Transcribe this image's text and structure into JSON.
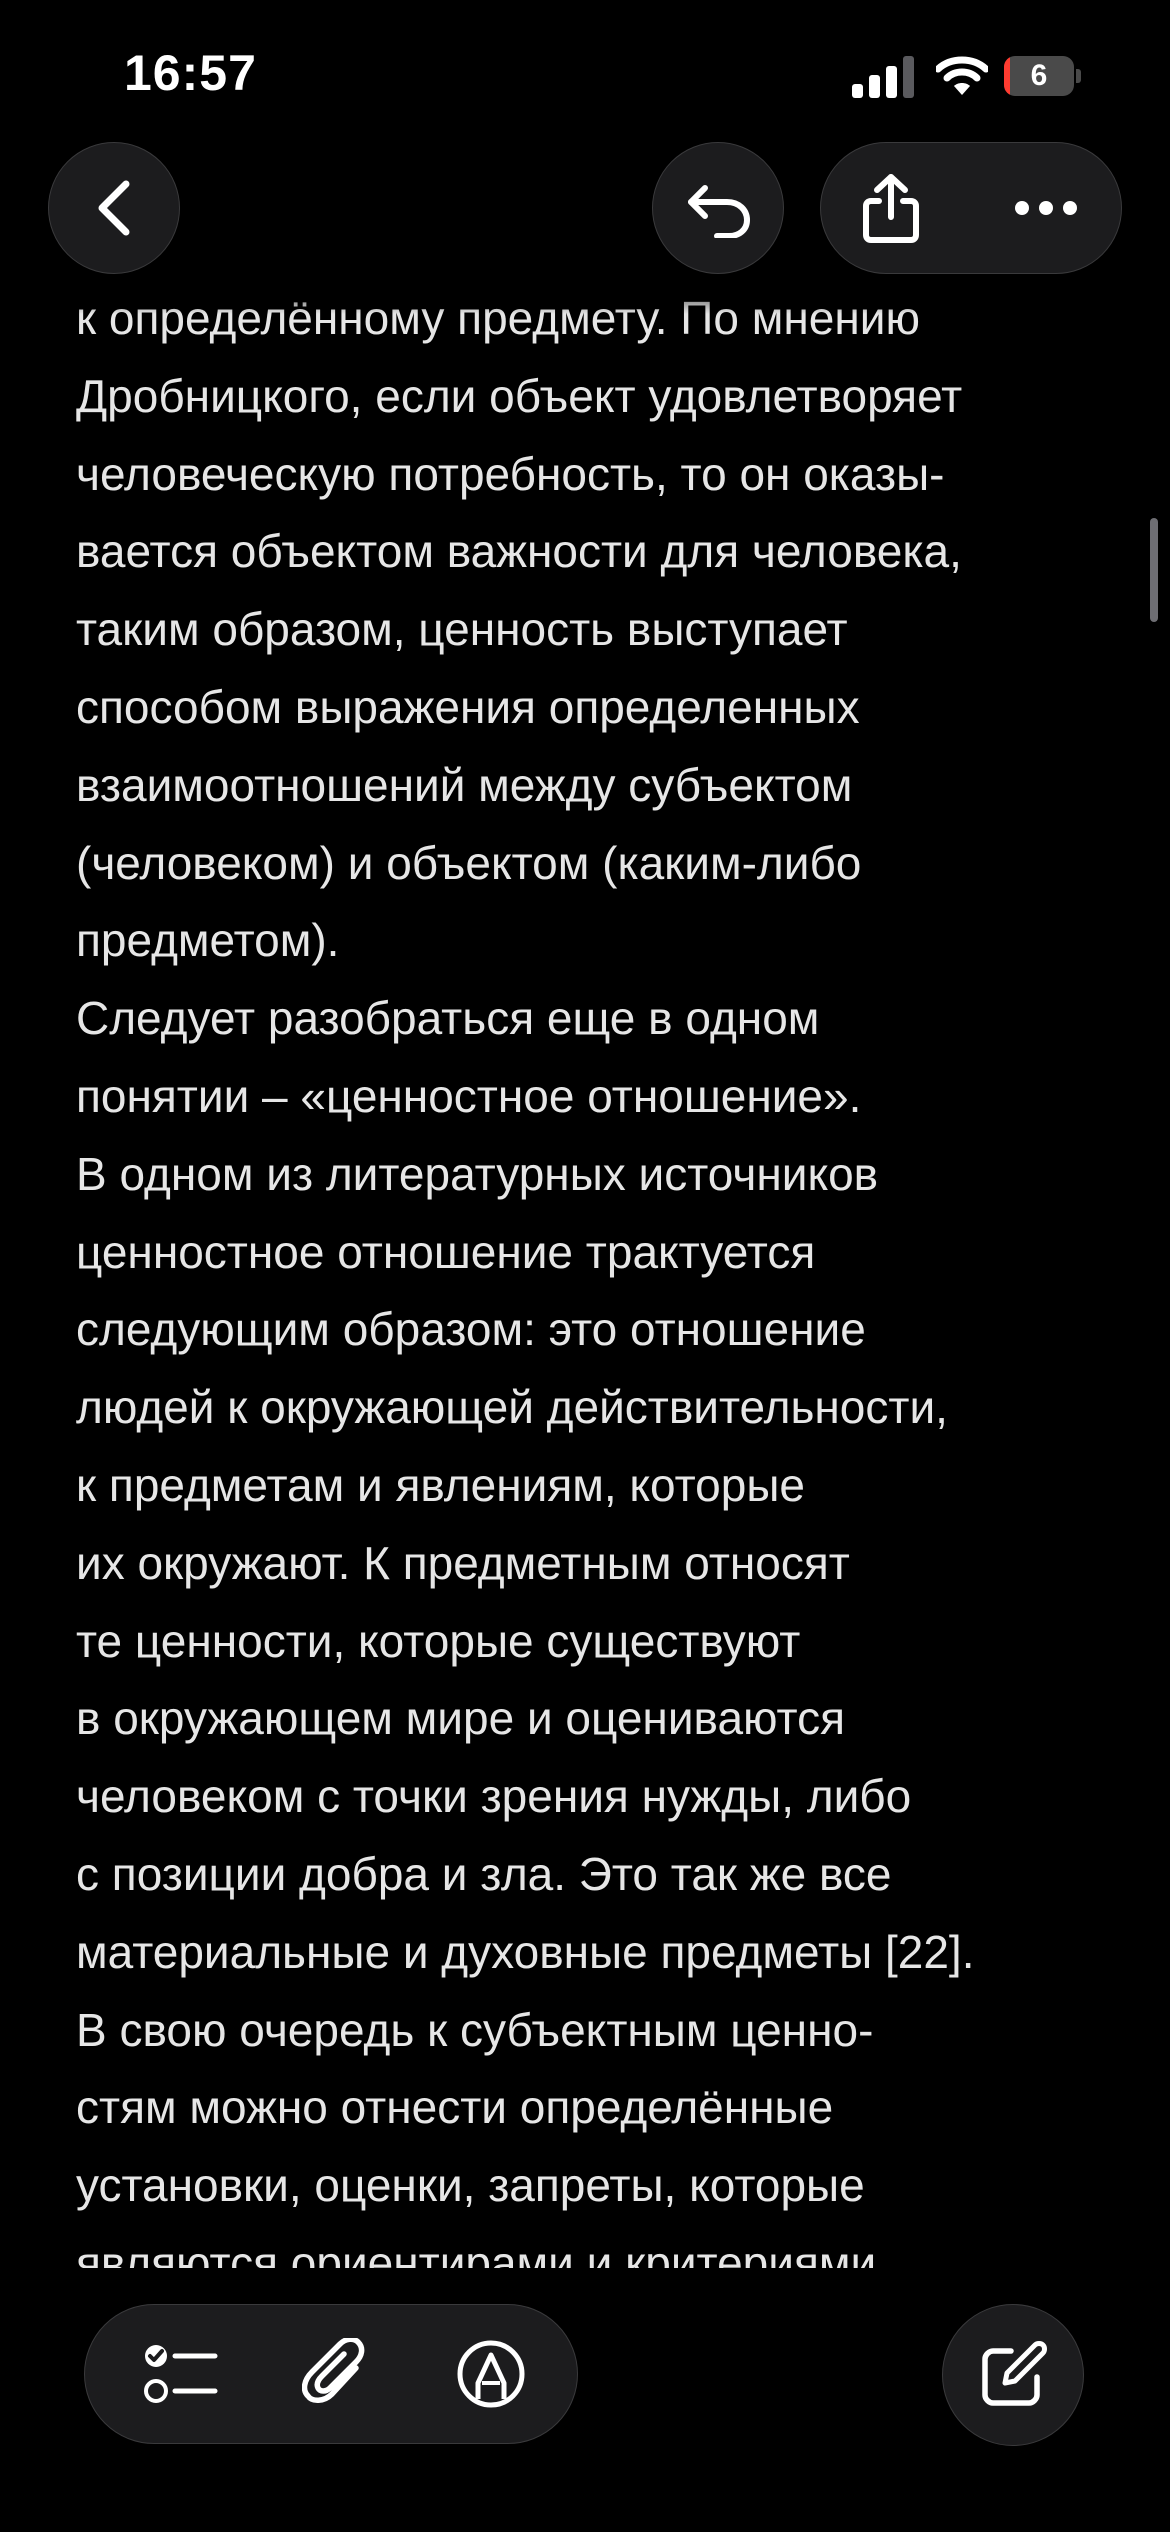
{
  "status_bar": {
    "time": "16:57",
    "battery_level": "6",
    "battery_fraction": 0.06,
    "battery_color": "#ff3b30",
    "signal_icon": "cellular-signal-icon",
    "wifi_icon": "wifi-icon"
  },
  "toolbar": {
    "back_icon": "chevron-left-icon",
    "undo_icon": "undo-arrow-icon",
    "share_icon": "share-icon",
    "more_icon": "ellipsis-icon"
  },
  "note": {
    "lines": [
      "к определённому предмету. По мнению",
      "Дробницкого, если объект удовлетворяет",
      "человеческую потребность, то он оказы-",
      "вается объектом важности для человека,",
      "таким образом, ценность выступает",
      "способом выражения определенных",
      "взаимоотношений между субъектом",
      "(человеком) и объектом (каким-либо",
      "предметом).",
      "Следует разобраться еще в одном",
      "понятии – «ценностное отношение».",
      "В одном из литературных источников",
      "ценностное отношение трактуется",
      "следующим образом: это отношение",
      "людей к окружающей действительности,",
      "к предметам и явлениям, которые",
      "их окружают. К предметным относят",
      "те ценности, которые существуют",
      "в окружающем мире и оцениваются",
      "человеком с точки зрения нужды, либо",
      "с позиции добра и зла. Это так же все",
      "материальные и духовные предметы [22].",
      "В свою очередь к субъектным ценно-",
      "стям можно отнести определённые",
      "установки, оценки, запреты, которые",
      "являются ориентирами и критериями"
    ]
  },
  "bottom_toolbar": {
    "checklist_icon": "checklist-icon",
    "attach_icon": "paperclip-icon",
    "markup_icon": "pen-markup-icon",
    "compose_icon": "compose-icon"
  }
}
